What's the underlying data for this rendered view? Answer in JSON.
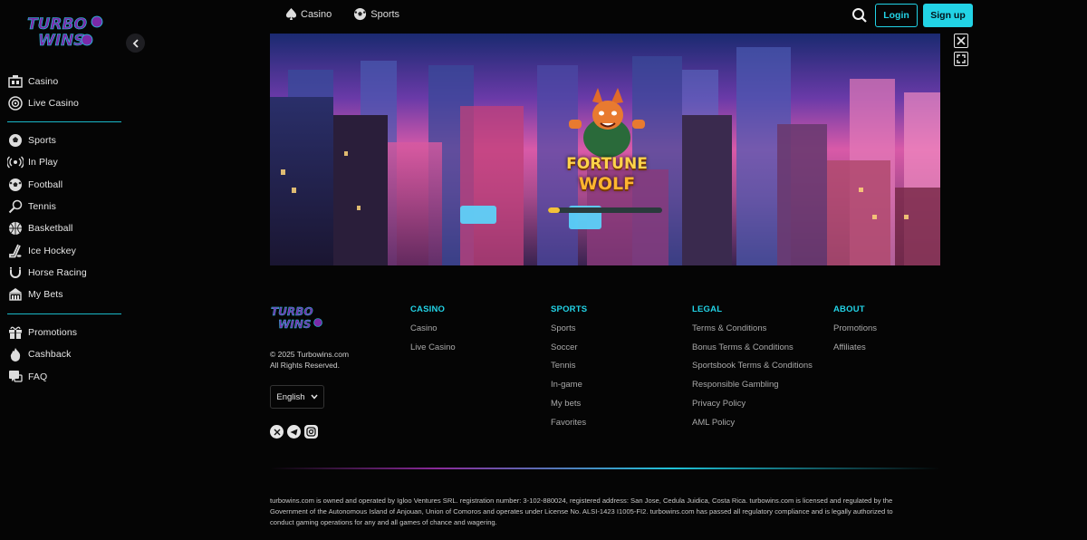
{
  "brand": {
    "logo_line1": "TURBO",
    "logo_line2": "WINS",
    "accent_color": "#22d3e6",
    "logo_color": "#7a2aa8"
  },
  "sidebar": {
    "group1": [
      {
        "label": "Casino",
        "icon": "casino-icon"
      },
      {
        "label": "Live Casino",
        "icon": "live-casino-icon"
      }
    ],
    "group2": [
      {
        "label": "Sports",
        "icon": "sports-icon"
      },
      {
        "label": "In Play",
        "icon": "in-play-icon"
      },
      {
        "label": "Football",
        "icon": "football-icon"
      },
      {
        "label": "Tennis",
        "icon": "tennis-icon"
      },
      {
        "label": "Basketball",
        "icon": "basketball-icon"
      },
      {
        "label": "Ice Hockey",
        "icon": "ice-hockey-icon"
      },
      {
        "label": "Horse Racing",
        "icon": "horse-racing-icon"
      },
      {
        "label": "My Bets",
        "icon": "my-bets-icon"
      }
    ],
    "group3": [
      {
        "label": "Promotions",
        "icon": "gift-icon"
      },
      {
        "label": "Cashback",
        "icon": "fire-icon"
      },
      {
        "label": "FAQ",
        "icon": "faq-icon"
      }
    ]
  },
  "topnav": {
    "casino": "Casino",
    "sports": "Sports"
  },
  "auth": {
    "login": "Login",
    "signup": "Sign up"
  },
  "game": {
    "title_line1": "FORTUNE",
    "title_line2": "WOLF",
    "loading_progress": 0.1
  },
  "footer": {
    "copyright_line1": "© 2025 Turbowins.com",
    "copyright_line2": "All Rights Reserved.",
    "language": "English",
    "socials": [
      "x-icon",
      "telegram-icon",
      "instagram-icon"
    ],
    "columns": [
      {
        "heading": "CASINO",
        "links": [
          "Casino",
          "Live Casino"
        ]
      },
      {
        "heading": "SPORTS",
        "links": [
          "Sports",
          "Soccer",
          "Tennis",
          "In-game",
          "My bets",
          "Favorites"
        ]
      },
      {
        "heading": "LEGAL",
        "links": [
          "Terms & Conditions",
          "Bonus Terms & Conditions",
          "Sportsbook Terms & Conditions",
          "Responsible Gambling",
          "Privacy Policy",
          "AML Policy"
        ]
      },
      {
        "heading": "ABOUT",
        "links": [
          "Promotions",
          "Affiliates"
        ]
      }
    ],
    "legal_text_1": "turbowins.com is owned and operated by Igloo Ventures SRL. registration number: 3-102-880024, registered address: San Jose, Cedula Juidica, Costa Rica. turbowins.com is licensed and regulated by the",
    "legal_text_2": "Government of the Autonomous Island of Anjouan, Union of Comoros and operates under License No. ALSI-1423 I1005-FI2. turbowins.com has passed all regulatory compliance and is legally authorized to",
    "legal_text_3": "conduct gaming operations for any and all games of chance and wagering."
  }
}
